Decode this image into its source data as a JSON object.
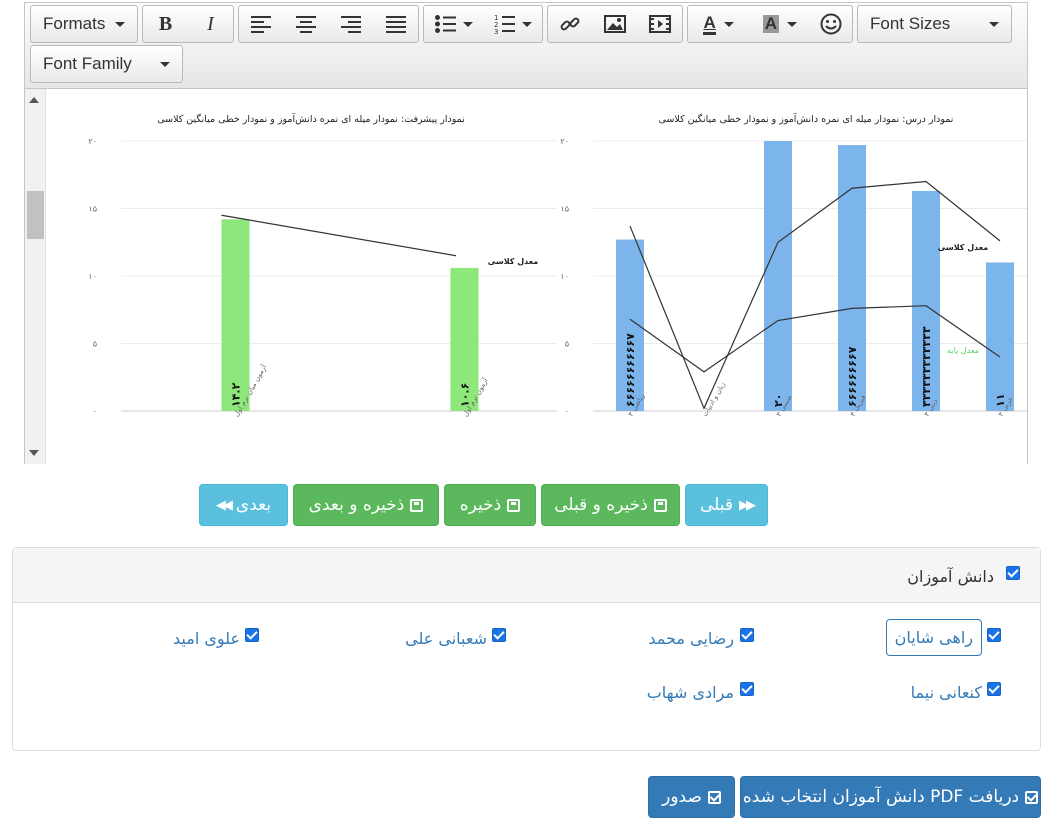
{
  "toolbar": {
    "formats_label": "Formats",
    "bold_label": "B",
    "italic_label": "I",
    "font_sizes_label": "Font Sizes",
    "font_family_label": "Font Family",
    "text_color_label": "A",
    "bg_color_label": "A"
  },
  "charts": {
    "left": {
      "title": "نمودار پیشرفت: نمودار میله ای نمره دانش‌آموز و نمودار خطی میانگین کلاسی",
      "y_ticks": [
        "۰",
        "۵",
        "۱۰",
        "۱۵",
        "۲۰"
      ],
      "bar_labels": [
        "۱۴.۲",
        "۱۰.۶"
      ],
      "line_label": "معدل کلاسی",
      "x_labels": [
        "آزمون میان ترم اول",
        "آزمون ترم اول"
      ]
    },
    "right": {
      "title": "نمودار درس: نمودار میله ای نمره دانش‌آموز و نمودار خطی میانگین کلاسی",
      "y_ticks": [
        "۰",
        "۵",
        "۱۰",
        "۱۵",
        "۲۰"
      ],
      "bar_labels": [
        "۶۶۶۶۶۶۶۶۶۶۷",
        "",
        "۲۰",
        "۶۶۶۶۶۶۶۶۷",
        "۳۳۳۳۳۳۳۳۳۳۳۳",
        "۱۱"
      ],
      "line_label_avg": "معدل کلاسی",
      "line_label_base": "معدل پایه",
      "x_labels": [
        "ریاضی ۳",
        "زبان و ادبیات",
        "شیمی ۳",
        "فیزیک ۳",
        "دینی ۳",
        "عربی ۳"
      ]
    }
  },
  "chart_data": [
    {
      "type": "bar",
      "title": "نمودار پیشرفت: نمودار میله ای نمره دانش‌آموز و نمودار خطی میانگین کلاسی",
      "categories": [
        "آزمون میان ترم اول",
        "آزمون ترم اول"
      ],
      "ylim": [
        0,
        20
      ],
      "series": [
        {
          "values": [
            14.2,
            10.6
          ]
        },
        {
          "name": "معدل کلاسی",
          "values": [
            14.5,
            11.5
          ]
        }
      ]
    },
    {
      "type": "bar",
      "title": "نمودار درس: نمودار میله ای نمره دانش‌آموز و نمودار خطی میانگین کلاسی",
      "categories": [
        "ریاضی ۳",
        "زبان و ادبیات",
        "شیمی ۳",
        "فیزیک ۳",
        "دینی ۳",
        "عربی ۳"
      ],
      "ylim": [
        0,
        20
      ],
      "series": [
        {
          "values": [
            12.7,
            0,
            20,
            19.7,
            16.3,
            11
          ]
        },
        {
          "name": "معدل کلاسی",
          "values": [
            13.7,
            0.2,
            12.5,
            16.5,
            17,
            12.6
          ]
        },
        {
          "name": "معدل پایه",
          "values": [
            6.8,
            2.9,
            6.7,
            7.6,
            7.8,
            4
          ]
        }
      ]
    }
  ],
  "nav": {
    "prev_label": "قبلی",
    "save_prev_label": "ذخیره و قبلی",
    "save_label": "ذخیره",
    "save_next_label": "ذخیره و بعدی",
    "next_label": "بعدی"
  },
  "students": {
    "header_label": "دانش آموزان",
    "items": [
      "راهی شایان",
      "رضایی محمد",
      "شعبانی علی",
      "علوی امید",
      "کنعانی نیما",
      "مرادی شهاب"
    ]
  },
  "actions": {
    "pdf_label": "دریافت PDF دانش آموزان انتخاب شده",
    "issue_label": "صدور"
  },
  "colors": {
    "bar_green": "#8ee77a",
    "bar_blue": "#7cb5ec",
    "info": "#5bc0de",
    "success": "#5cb85c",
    "primary": "#337ab7"
  }
}
